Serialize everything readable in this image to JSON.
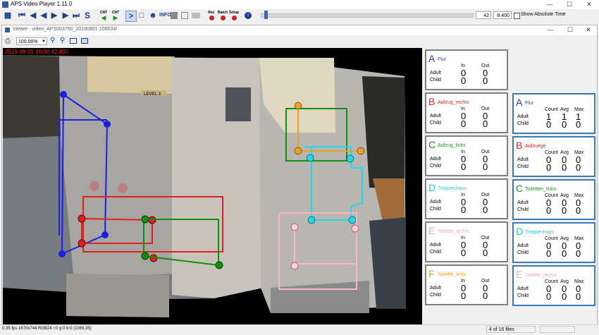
{
  "app": {
    "title": "APS Video Player 1.11.0"
  },
  "toolbar": {
    "cnt1": "CNT",
    "cnt2": "CNT",
    "info": "INFO",
    "rec": "Rec",
    "batch": "Batch",
    "setup": "Setup",
    "frame": "42",
    "time": "8.400",
    "show_abs": "Show Absolute Time"
  },
  "viewer": {
    "title": "Viewer - video_APS003750_20190801-100034/",
    "zoom": "100.00%",
    "timestamp": "2019-08-01 10:00:42.400"
  },
  "left_panels": [
    {
      "letter": "A",
      "zone": "Flur",
      "color": "#2040c0",
      "in_label": "In",
      "out_label": "Out",
      "adult_label": "Adult",
      "child_label": "Child",
      "adult_in": "0",
      "adult_out": "0",
      "child_in": "0",
      "child_out": "0"
    },
    {
      "letter": "B",
      "zone": "Aufzug_rechts",
      "color": "#e02020",
      "in_label": "In",
      "out_label": "Out",
      "adult_label": "Adult",
      "child_label": "Child",
      "adult_in": "0",
      "adult_out": "0",
      "child_in": "0",
      "child_out": "0"
    },
    {
      "letter": "C",
      "zone": "Aufzug_links",
      "color": "#209020",
      "in_label": "In",
      "out_label": "Out",
      "adult_label": "Adult",
      "child_label": "Child",
      "adult_in": "0",
      "adult_out": "0",
      "child_in": "0",
      "child_out": "0"
    },
    {
      "letter": "D",
      "zone": "Treppenhaus",
      "color": "#20c8e0",
      "in_label": "In",
      "out_label": "Out",
      "adult_label": "Adult",
      "child_label": "Child",
      "adult_in": "0",
      "adult_out": "0",
      "child_in": "0",
      "child_out": "0"
    },
    {
      "letter": "E",
      "zone": "Toilette_rechts",
      "color": "#f0a8b8",
      "in_label": "In",
      "out_label": "Out",
      "adult_label": "Adult",
      "child_label": "Child",
      "adult_in": "0",
      "adult_out": "0",
      "child_in": "0",
      "child_out": "0"
    },
    {
      "letter": "F",
      "zone": "Toilette_links",
      "color": "#f0a020",
      "in_label": "In",
      "out_label": "Out",
      "adult_label": "Adult",
      "child_label": "Child",
      "adult_in": "0",
      "adult_out": "0",
      "child_in": "0",
      "child_out": "0"
    }
  ],
  "right_panels": [
    {
      "letter": "A",
      "zone": "Flur",
      "color": "#2040c0",
      "count_label": "Count",
      "avg_label": "Avg",
      "max_label": "Max",
      "adult_label": "Adult",
      "child_label": "Child",
      "adult": [
        "1",
        "1",
        "1"
      ],
      "child": [
        "0",
        "0",
        "0"
      ]
    },
    {
      "letter": "B",
      "zone": "Aufzuege",
      "color": "#e02020",
      "count_label": "Count",
      "avg_label": "Avg",
      "max_label": "Max",
      "adult_label": "Adult",
      "child_label": "Child",
      "adult": [
        "0",
        "0",
        "0"
      ],
      "child": [
        "0",
        "0",
        "0"
      ]
    },
    {
      "letter": "C",
      "zone": "Toiletten_links",
      "color": "#209020",
      "count_label": "Count",
      "avg_label": "Avg",
      "max_label": "Max",
      "adult_label": "Adult",
      "child_label": "Child",
      "adult": [
        "0",
        "0",
        "0"
      ],
      "child": [
        "0",
        "0",
        "0"
      ]
    },
    {
      "letter": "D",
      "zone": "Treppenhaus",
      "color": "#20c8e0",
      "count_label": "Count",
      "avg_label": "Avg",
      "max_label": "Max",
      "adult_label": "Adult",
      "child_label": "Child",
      "adult": [
        "0",
        "0",
        "0"
      ],
      "child": [
        "0",
        "0",
        "0"
      ]
    },
    {
      "letter": "E",
      "zone": "Toilette_rechts",
      "color": "#f0a8b8",
      "count_label": "Count",
      "avg_label": "Avg",
      "max_label": "Max",
      "adult_label": "Adult",
      "child_label": "Child",
      "adult": [
        "0",
        "0",
        "0"
      ],
      "child": [
        "0",
        "0",
        "0"
      ]
    }
  ],
  "status": {
    "left": "0.35 fps  1670x744 RGB24  r:0 g:0 b:0 (1069,35)",
    "files": "4 of 16 files"
  },
  "floor_labels": {
    "level": "LEVEL 2"
  }
}
